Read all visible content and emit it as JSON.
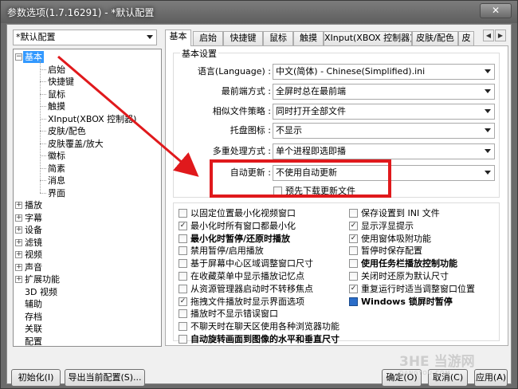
{
  "window": {
    "title": "参数选项(1.7.16291) - *默认配置",
    "close_label": "✕"
  },
  "profile_select": {
    "value": "*默认配置"
  },
  "tree": {
    "items": [
      {
        "label": "基本",
        "level": 0,
        "expanded": true,
        "selected": true
      },
      {
        "label": "启始",
        "level": 1
      },
      {
        "label": "快捷键",
        "level": 1
      },
      {
        "label": "鼠标",
        "level": 1
      },
      {
        "label": "触摸",
        "level": 1
      },
      {
        "label": "XInput(XBOX 控制器)",
        "level": 1
      },
      {
        "label": "皮肤/配色",
        "level": 1
      },
      {
        "label": "皮肤覆盖/放大",
        "level": 1
      },
      {
        "label": "徽标",
        "level": 1
      },
      {
        "label": "简素",
        "level": 1
      },
      {
        "label": "消息",
        "level": 1
      },
      {
        "label": "界面",
        "level": 1
      },
      {
        "label": "播放",
        "level": 0,
        "expander": true
      },
      {
        "label": "字幕",
        "level": 0,
        "expander": true
      },
      {
        "label": "设备",
        "level": 0,
        "expander": true
      },
      {
        "label": "滤镜",
        "level": 0,
        "expander": true
      },
      {
        "label": "视频",
        "level": 0,
        "expander": true
      },
      {
        "label": "声音",
        "level": 0,
        "expander": true
      },
      {
        "label": "扩展功能",
        "level": 0,
        "expander": true
      },
      {
        "label": "3D 视频",
        "level": 0
      },
      {
        "label": "辅助",
        "level": 0
      },
      {
        "label": "存档",
        "level": 0
      },
      {
        "label": "关联",
        "level": 0
      },
      {
        "label": "配置",
        "level": 0
      }
    ]
  },
  "tabs": [
    {
      "label": "基本",
      "active": true
    },
    {
      "label": "启始"
    },
    {
      "label": "快捷键"
    },
    {
      "label": "鼠标"
    },
    {
      "label": "触摸"
    },
    {
      "label": "XInput(XBOX 控制器)"
    },
    {
      "label": "皮肤/配色"
    },
    {
      "label": "皮"
    }
  ],
  "tab_scroll": {
    "left": "◀",
    "right": "▶"
  },
  "basic": {
    "group_title": "基本设置",
    "settings": [
      {
        "label": "语言(Language) :",
        "value": "中文(简体) - Chinese(Simplified).ini"
      },
      {
        "label": "最前端方式 :",
        "value": "全屏时总在最前端"
      },
      {
        "label": "相似文件策略 :",
        "value": "同时打开全部文件"
      },
      {
        "label": "托盘图标 :",
        "value": "不显示"
      },
      {
        "label": "多重处理方式 :",
        "value": "单个进程即选即播"
      },
      {
        "label": "自动更新 :",
        "value": "不使用自动更新"
      }
    ],
    "predownload": {
      "label": "预先下载更新文件",
      "checked": false
    }
  },
  "options_left": [
    {
      "label": "以固定位置最小化视频窗口",
      "checked": false
    },
    {
      "label": "最小化时所有窗口都最小化",
      "checked": true
    },
    {
      "label": "最小化时暂停/还原时播放",
      "checked": false,
      "bold": true
    },
    {
      "label": "禁用暂停/启用播放",
      "checked": false
    },
    {
      "label": "基于屏幕中心区域调整窗口尺寸",
      "checked": false
    },
    {
      "label": "在收藏菜单中显示播放记忆点",
      "checked": false
    },
    {
      "label": "从资源管理器启动时不转移焦点",
      "checked": false
    },
    {
      "label": "拖拽文件播放时显示界面选项",
      "checked": true
    },
    {
      "label": "播放时不显示错误窗口",
      "checked": false
    },
    {
      "label": "不聊天时在聊天区使用各种浏览器功能",
      "checked": false
    },
    {
      "label": "自动旋转画面到图像的水平和垂直尺寸",
      "checked": false,
      "bold": true
    }
  ],
  "options_right": [
    {
      "label": "保存设置到 INI 文件",
      "checked": false
    },
    {
      "label": "显示浮显提示",
      "checked": true
    },
    {
      "label": "使用窗体吸附功能",
      "checked": true
    },
    {
      "label": "暂停时保存配置",
      "checked": false
    },
    {
      "label": "使用任务栏播放控制功能",
      "checked": false,
      "bold": true
    },
    {
      "label": "关闭时还原为默认尺寸",
      "checked": false
    },
    {
      "label": "重复运行时适当调整窗口位置",
      "checked": true
    },
    {
      "label": "Windows 锁屏时暂停",
      "checked": true,
      "bold": true,
      "icon": true
    }
  ],
  "buttons": {
    "init": "初始化(I)",
    "export": "导出当前配置(S)...",
    "ok": "确定(O)",
    "cancel": "取消(C)",
    "apply": "应用(A)"
  },
  "watermark": {
    "logo": "3HE 当游网",
    "sub": "DANGYOU.COM"
  },
  "colors": {
    "highlight": "#e0191c",
    "selection": "#3399ff"
  }
}
